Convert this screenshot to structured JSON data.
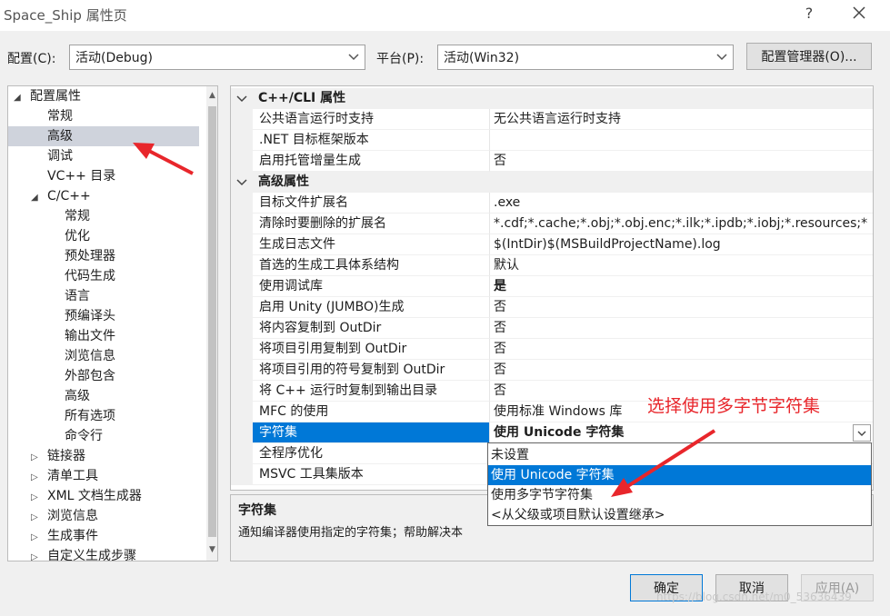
{
  "window": {
    "title": "Space_Ship 属性页",
    "help_glyph": "?"
  },
  "toolbar": {
    "config_label": "配置(C):",
    "config_value": "活动(Debug)",
    "platform_label": "平台(P):",
    "platform_value": "活动(Win32)",
    "config_manager_label": "配置管理器(O)..."
  },
  "tree": {
    "items": [
      {
        "label": "配置属性",
        "twisty": "◢"
      },
      {
        "label": "常规"
      },
      {
        "label": "高级"
      },
      {
        "label": "调试"
      },
      {
        "label": "VC++ 目录"
      },
      {
        "label": "C/C++",
        "twisty": "◢"
      },
      {
        "label": "常规"
      },
      {
        "label": "优化"
      },
      {
        "label": "预处理器"
      },
      {
        "label": "代码生成"
      },
      {
        "label": "语言"
      },
      {
        "label": "预编译头"
      },
      {
        "label": "输出文件"
      },
      {
        "label": "浏览信息"
      },
      {
        "label": "外部包含"
      },
      {
        "label": "高级"
      },
      {
        "label": "所有选项"
      },
      {
        "label": "命令行"
      },
      {
        "label": "链接器",
        "twisty": "▷"
      },
      {
        "label": "清单工具",
        "twisty": "▷"
      },
      {
        "label": "XML 文档生成器",
        "twisty": "▷"
      },
      {
        "label": "浏览信息",
        "twisty": "▷"
      },
      {
        "label": "生成事件",
        "twisty": "▷"
      },
      {
        "label": "自定义生成步骤",
        "twisty": "▷"
      }
    ],
    "selected_index": 2,
    "scroll_up": "▲",
    "scroll_down": "▼"
  },
  "grid": {
    "categories": [
      {
        "label": "C++/CLI 属性"
      },
      {
        "label": "高级属性"
      }
    ],
    "cli_rows": [
      {
        "name": "公共语言运行时支持",
        "value": "无公共语言运行时支持"
      },
      {
        "name": ".NET 目标框架版本",
        "value": ""
      },
      {
        "name": "启用托管增量生成",
        "value": "否"
      }
    ],
    "adv_rows": [
      {
        "name": "目标文件扩展名",
        "value": ".exe"
      },
      {
        "name": "清除时要删除的扩展名",
        "value": "*.cdf;*.cache;*.obj;*.obj.enc;*.ilk;*.ipdb;*.iobj;*.resources;*"
      },
      {
        "name": "生成日志文件",
        "value": "$(IntDir)$(MSBuildProjectName).log"
      },
      {
        "name": "首选的生成工具体系结构",
        "value": "默认"
      },
      {
        "name": "使用调试库",
        "value": "是"
      },
      {
        "name": "启用 Unity (JUMBO)生成",
        "value": "否"
      },
      {
        "name": "将内容复制到 OutDir",
        "value": "否"
      },
      {
        "name": "将项目引用复制到 OutDir",
        "value": "否"
      },
      {
        "name": "将项目引用的符号复制到 OutDir",
        "value": "否"
      },
      {
        "name": "将 C++ 运行时复制到输出目录",
        "value": "否"
      },
      {
        "name": "MFC 的使用",
        "value": "使用标准 Windows 库"
      },
      {
        "name": "字符集",
        "value": "使用 Unicode 字符集"
      },
      {
        "name": "全程序优化",
        "value": ""
      },
      {
        "name": "MSVC 工具集版本",
        "value": ""
      }
    ]
  },
  "dropdown": {
    "options": [
      {
        "label": "未设置"
      },
      {
        "label": "使用 Unicode 字符集"
      },
      {
        "label": "使用多字节字符集"
      },
      {
        "label": "<从父级或项目默认设置继承>"
      }
    ],
    "highlighted_index": 1
  },
  "description": {
    "title": "字符集",
    "text": "通知编译器使用指定的字符集；帮助解决本"
  },
  "footer": {
    "ok_label": "确定",
    "cancel_label": "取消",
    "apply_label": "应用(A)"
  },
  "annotations": {
    "note": "选择使用多字节字符集",
    "watermark": "https://blog.csdn.net/m0_53636439"
  },
  "colors": {
    "accent": "#0078d7",
    "annotation": "#e8262b",
    "tree_selected": "#cfd3dc"
  }
}
